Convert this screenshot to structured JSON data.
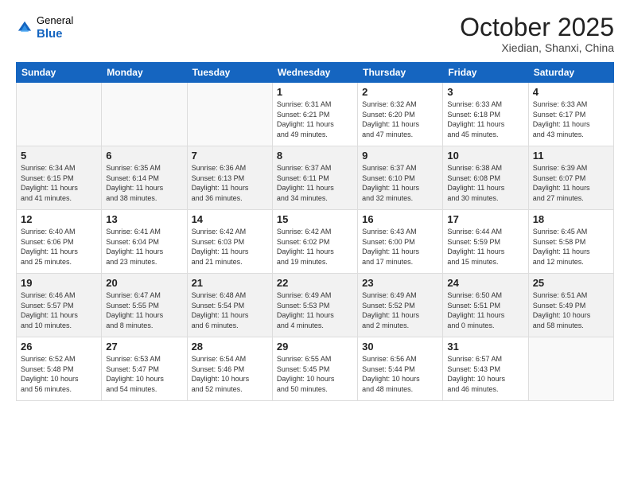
{
  "header": {
    "logo": {
      "general": "General",
      "blue": "Blue"
    },
    "title": "October 2025",
    "location": "Xiedian, Shanxi, China"
  },
  "days_of_week": [
    "Sunday",
    "Monday",
    "Tuesday",
    "Wednesday",
    "Thursday",
    "Friday",
    "Saturday"
  ],
  "weeks": [
    [
      {
        "day": "",
        "info": ""
      },
      {
        "day": "",
        "info": ""
      },
      {
        "day": "",
        "info": ""
      },
      {
        "day": "1",
        "info": "Sunrise: 6:31 AM\nSunset: 6:21 PM\nDaylight: 11 hours\nand 49 minutes."
      },
      {
        "day": "2",
        "info": "Sunrise: 6:32 AM\nSunset: 6:20 PM\nDaylight: 11 hours\nand 47 minutes."
      },
      {
        "day": "3",
        "info": "Sunrise: 6:33 AM\nSunset: 6:18 PM\nDaylight: 11 hours\nand 45 minutes."
      },
      {
        "day": "4",
        "info": "Sunrise: 6:33 AM\nSunset: 6:17 PM\nDaylight: 11 hours\nand 43 minutes."
      }
    ],
    [
      {
        "day": "5",
        "info": "Sunrise: 6:34 AM\nSunset: 6:15 PM\nDaylight: 11 hours\nand 41 minutes."
      },
      {
        "day": "6",
        "info": "Sunrise: 6:35 AM\nSunset: 6:14 PM\nDaylight: 11 hours\nand 38 minutes."
      },
      {
        "day": "7",
        "info": "Sunrise: 6:36 AM\nSunset: 6:13 PM\nDaylight: 11 hours\nand 36 minutes."
      },
      {
        "day": "8",
        "info": "Sunrise: 6:37 AM\nSunset: 6:11 PM\nDaylight: 11 hours\nand 34 minutes."
      },
      {
        "day": "9",
        "info": "Sunrise: 6:37 AM\nSunset: 6:10 PM\nDaylight: 11 hours\nand 32 minutes."
      },
      {
        "day": "10",
        "info": "Sunrise: 6:38 AM\nSunset: 6:08 PM\nDaylight: 11 hours\nand 30 minutes."
      },
      {
        "day": "11",
        "info": "Sunrise: 6:39 AM\nSunset: 6:07 PM\nDaylight: 11 hours\nand 27 minutes."
      }
    ],
    [
      {
        "day": "12",
        "info": "Sunrise: 6:40 AM\nSunset: 6:06 PM\nDaylight: 11 hours\nand 25 minutes."
      },
      {
        "day": "13",
        "info": "Sunrise: 6:41 AM\nSunset: 6:04 PM\nDaylight: 11 hours\nand 23 minutes."
      },
      {
        "day": "14",
        "info": "Sunrise: 6:42 AM\nSunset: 6:03 PM\nDaylight: 11 hours\nand 21 minutes."
      },
      {
        "day": "15",
        "info": "Sunrise: 6:42 AM\nSunset: 6:02 PM\nDaylight: 11 hours\nand 19 minutes."
      },
      {
        "day": "16",
        "info": "Sunrise: 6:43 AM\nSunset: 6:00 PM\nDaylight: 11 hours\nand 17 minutes."
      },
      {
        "day": "17",
        "info": "Sunrise: 6:44 AM\nSunset: 5:59 PM\nDaylight: 11 hours\nand 15 minutes."
      },
      {
        "day": "18",
        "info": "Sunrise: 6:45 AM\nSunset: 5:58 PM\nDaylight: 11 hours\nand 12 minutes."
      }
    ],
    [
      {
        "day": "19",
        "info": "Sunrise: 6:46 AM\nSunset: 5:57 PM\nDaylight: 11 hours\nand 10 minutes."
      },
      {
        "day": "20",
        "info": "Sunrise: 6:47 AM\nSunset: 5:55 PM\nDaylight: 11 hours\nand 8 minutes."
      },
      {
        "day": "21",
        "info": "Sunrise: 6:48 AM\nSunset: 5:54 PM\nDaylight: 11 hours\nand 6 minutes."
      },
      {
        "day": "22",
        "info": "Sunrise: 6:49 AM\nSunset: 5:53 PM\nDaylight: 11 hours\nand 4 minutes."
      },
      {
        "day": "23",
        "info": "Sunrise: 6:49 AM\nSunset: 5:52 PM\nDaylight: 11 hours\nand 2 minutes."
      },
      {
        "day": "24",
        "info": "Sunrise: 6:50 AM\nSunset: 5:51 PM\nDaylight: 11 hours\nand 0 minutes."
      },
      {
        "day": "25",
        "info": "Sunrise: 6:51 AM\nSunset: 5:49 PM\nDaylight: 10 hours\nand 58 minutes."
      }
    ],
    [
      {
        "day": "26",
        "info": "Sunrise: 6:52 AM\nSunset: 5:48 PM\nDaylight: 10 hours\nand 56 minutes."
      },
      {
        "day": "27",
        "info": "Sunrise: 6:53 AM\nSunset: 5:47 PM\nDaylight: 10 hours\nand 54 minutes."
      },
      {
        "day": "28",
        "info": "Sunrise: 6:54 AM\nSunset: 5:46 PM\nDaylight: 10 hours\nand 52 minutes."
      },
      {
        "day": "29",
        "info": "Sunrise: 6:55 AM\nSunset: 5:45 PM\nDaylight: 10 hours\nand 50 minutes."
      },
      {
        "day": "30",
        "info": "Sunrise: 6:56 AM\nSunset: 5:44 PM\nDaylight: 10 hours\nand 48 minutes."
      },
      {
        "day": "31",
        "info": "Sunrise: 6:57 AM\nSunset: 5:43 PM\nDaylight: 10 hours\nand 46 minutes."
      },
      {
        "day": "",
        "info": ""
      }
    ]
  ],
  "shaded_rows": [
    1,
    3
  ]
}
